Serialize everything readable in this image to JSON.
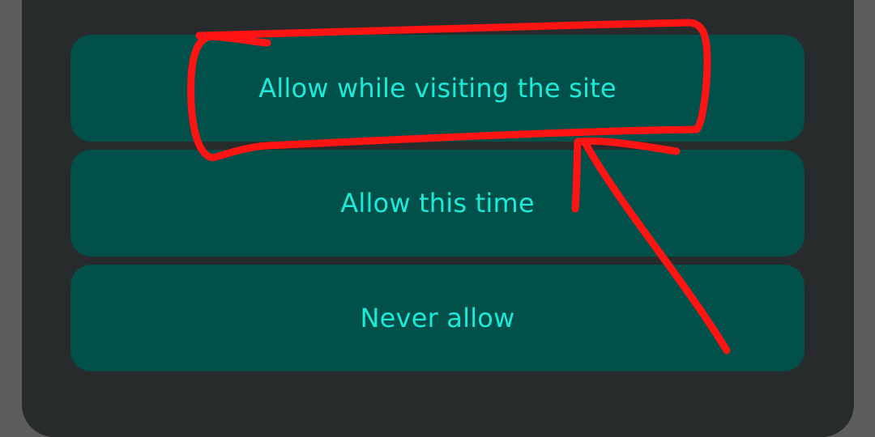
{
  "colors": {
    "background": "#5d5d5d",
    "dialog_background": "#272b2b",
    "button_background": "#02504a",
    "button_text": "#1de9d8",
    "annotation": "#ff1414"
  },
  "dialog": {
    "options": [
      {
        "label": "Allow while visiting the site"
      },
      {
        "label": "Allow this time"
      },
      {
        "label": "Never allow"
      }
    ]
  },
  "annotation": {
    "type": "highlight-circle-and-arrow",
    "target": "Allow while visiting the site"
  }
}
